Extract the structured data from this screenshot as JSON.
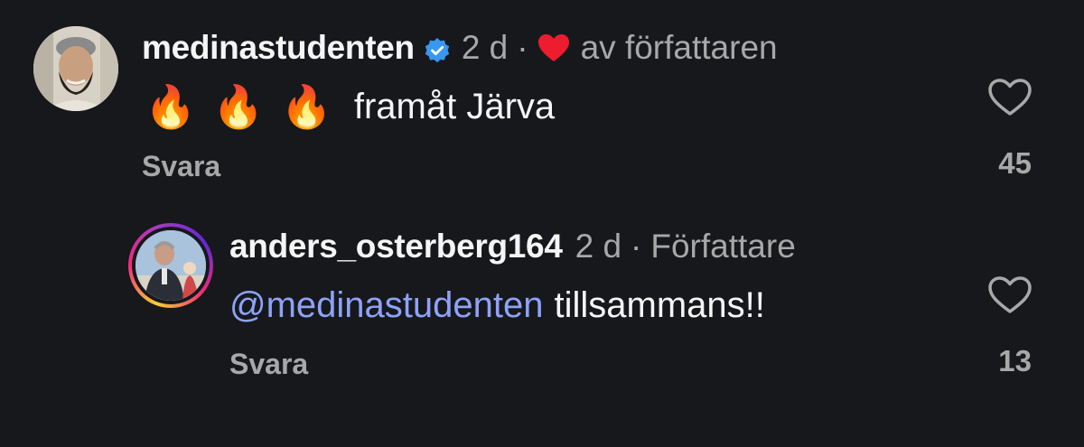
{
  "colors": {
    "background": "#16181c",
    "primary_text": "#f5f5f5",
    "secondary_text": "#a8a8a8",
    "mention": "#8ea2f7",
    "verified_badge": "#3897f0",
    "liked_heart": "#ed1c2e"
  },
  "comments": [
    {
      "username": "medinastudenten",
      "verified": true,
      "time": "2 d",
      "separator": "·",
      "liked_by_author_label": "av författaren",
      "emoji": [
        "🔥",
        "🔥",
        "🔥"
      ],
      "text": "framåt Järva",
      "reply_label": "Svara",
      "like_count": "45",
      "icons": [
        "verified-badge-icon",
        "red-heart-icon",
        "heart-outline-icon"
      ]
    },
    {
      "username": "anders_osterberg164",
      "time": "2 d",
      "separator": "·",
      "author_label": "Författare",
      "mention": "@medinastudenten",
      "text": "tillsammans!!",
      "reply_label": "Svara",
      "like_count": "13",
      "icons": [
        "story-ring-avatar",
        "heart-outline-icon"
      ]
    }
  ]
}
